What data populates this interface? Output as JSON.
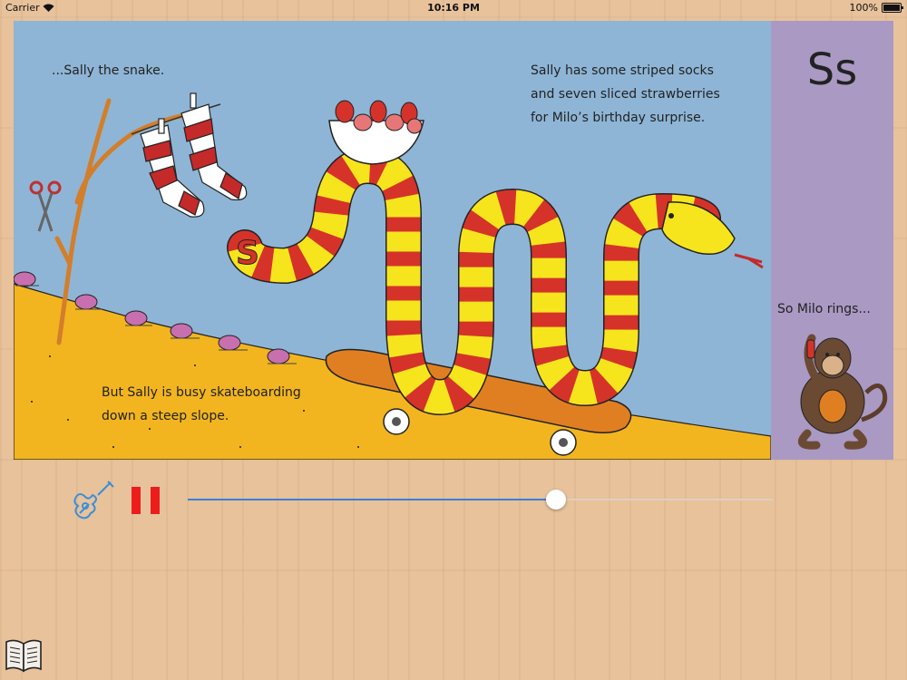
{
  "status_bar": {
    "carrier": "Carrier",
    "time": "10:16 PM",
    "battery": "100%"
  },
  "story": {
    "top_left": "...Sally the snake.",
    "top_right_lines": [
      "Sally has some striped socks",
      "and seven sliced strawberries",
      "for Milo’s birthday surprise."
    ],
    "bottom_left_lines": [
      "But Sally is busy skateboarding",
      "down a steep slope."
    ]
  },
  "letter_panel": {
    "letter": "Ss",
    "caption": "So Milo rings..."
  },
  "player": {
    "progress": 0.63
  },
  "icons": {
    "music": "guitar-icon",
    "pause": "pause-icon",
    "library": "book-icon"
  },
  "colors": {
    "sky": "#8eb5d6",
    "hill": "#f2b51f",
    "panel": "#a999c3",
    "accent": "#3b7fd6",
    "pause": "#ee1d1d"
  }
}
